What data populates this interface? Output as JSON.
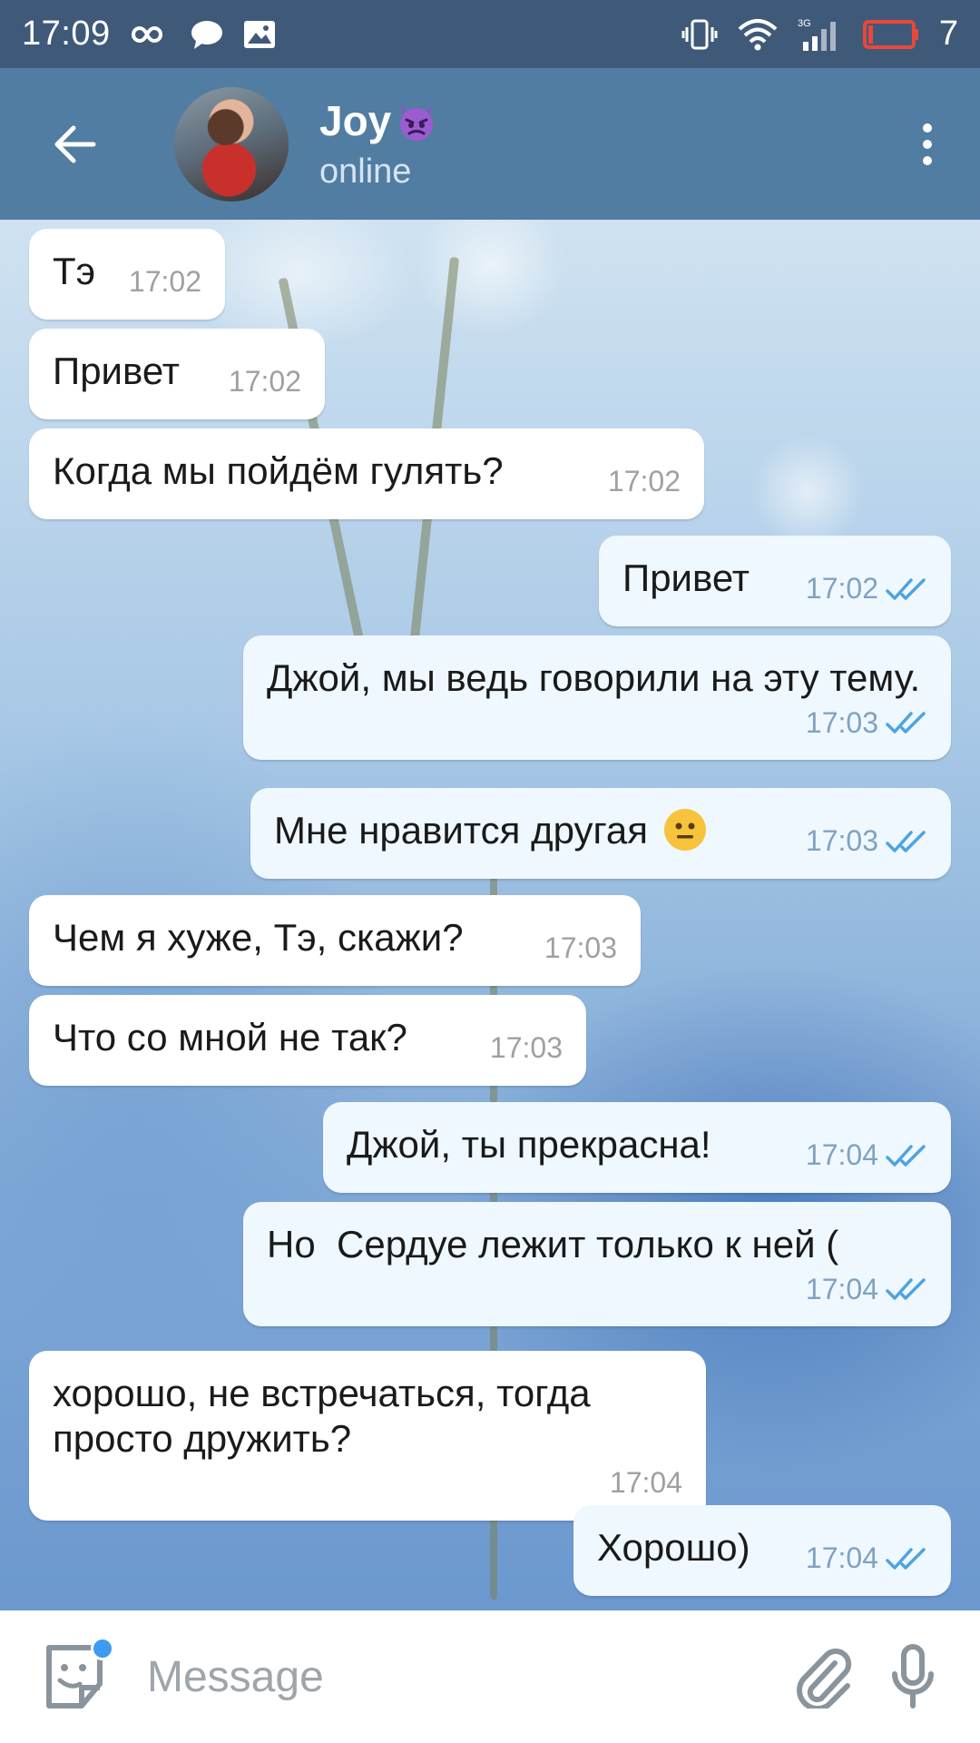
{
  "status_bar": {
    "time": "17:09",
    "battery_level": "7",
    "network_type": "3G",
    "icons": [
      "infinity-icon",
      "chat-bubble-icon",
      "image-icon",
      "vibrate-icon",
      "wifi-icon",
      "signal-icon",
      "battery-icon"
    ]
  },
  "header": {
    "contact_name": "Joy",
    "contact_emoji": "imp-devil-emoji",
    "status": "online"
  },
  "messages": [
    {
      "direction": "in",
      "text": "Тэ",
      "time": "17:02"
    },
    {
      "direction": "in",
      "text": "Привет",
      "time": "17:02"
    },
    {
      "direction": "in",
      "text": "Когда мы пойдём гулять?",
      "time": "17:02"
    },
    {
      "direction": "out",
      "text": "Привет",
      "time": "17:02",
      "read": true
    },
    {
      "direction": "out",
      "text": "Джой, мы ведь говорили на эту тему.",
      "time": "17:03",
      "read": true
    },
    {
      "direction": "out",
      "text": "Мне нравится другая",
      "emoji": "neutral-face",
      "time": "17:03",
      "read": true
    },
    {
      "direction": "in",
      "text": "Чем я хуже, Тэ, скажи?",
      "time": "17:03"
    },
    {
      "direction": "in",
      "text": "Что со мной не так?",
      "time": "17:03"
    },
    {
      "direction": "out",
      "text": "Джой, ты прекрасна!",
      "time": "17:04",
      "read": true
    },
    {
      "direction": "out",
      "text": "Но  Сердуе лежит только к ней (",
      "time": "17:04",
      "read": true
    },
    {
      "direction": "in",
      "text": "хорошо, не встречаться, тогда просто дружить?",
      "time": "17:04"
    },
    {
      "direction": "out",
      "text": "Хорошо)",
      "time": "17:04",
      "read": true
    }
  ],
  "input": {
    "placeholder": "Message",
    "value": ""
  },
  "colors": {
    "header": "#517da2",
    "status_bar": "#3f5a79",
    "incoming_bubble": "#ffffff",
    "outgoing_bubble": "#eff8ff",
    "read_check": "#4fa3e0",
    "notification_dot": "#3d9cf0"
  }
}
